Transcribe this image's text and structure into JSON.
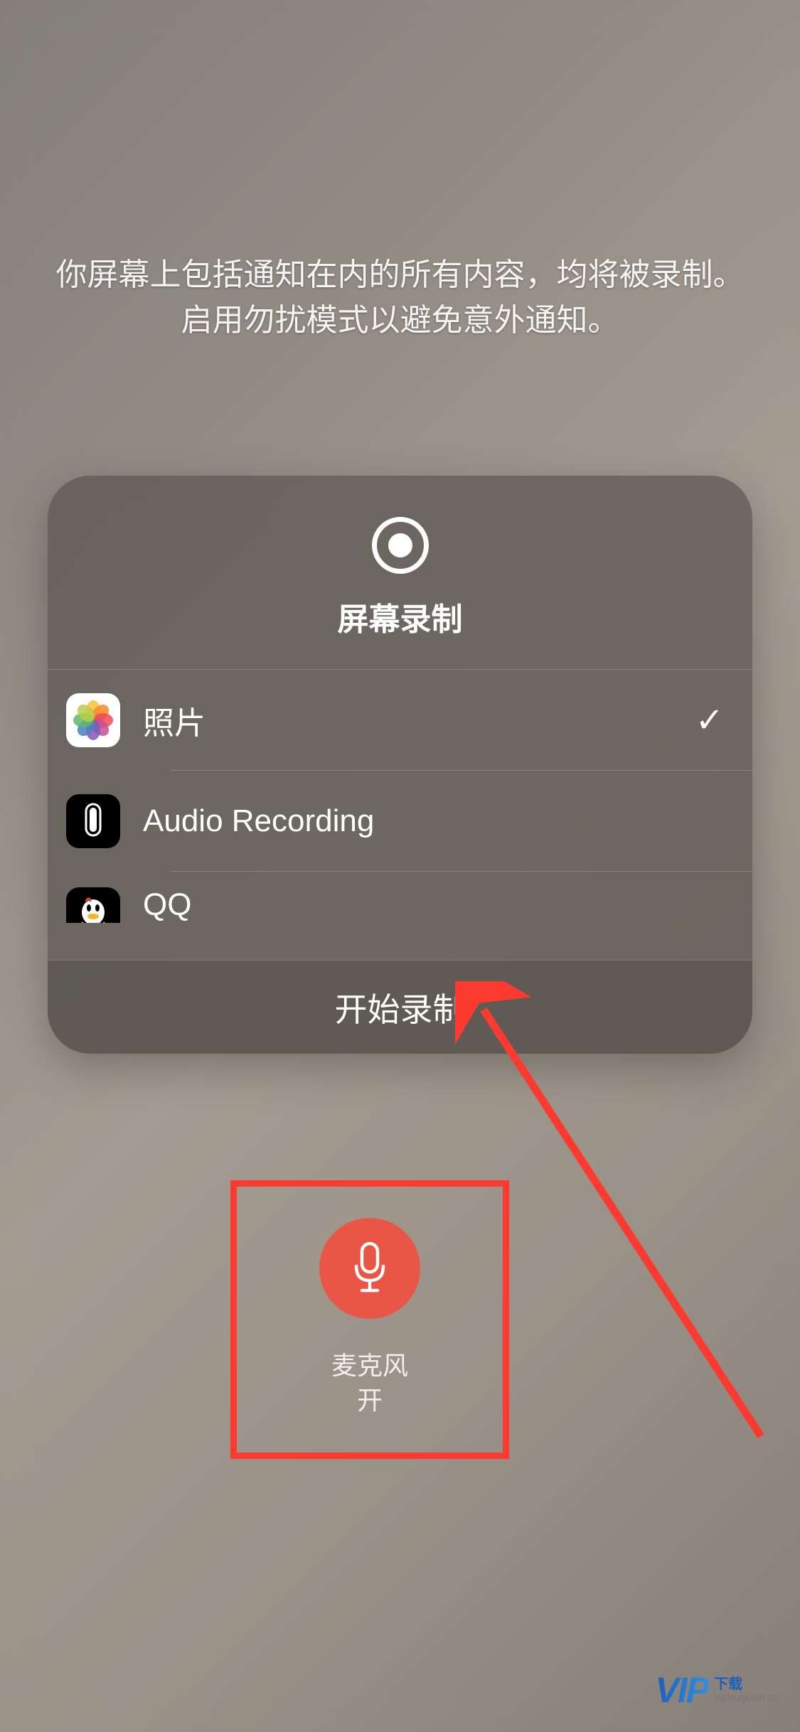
{
  "warning": "你屏幕上包括通知在内的所有内容，均将被录制。启用勿扰模式以避免意外通知。",
  "card": {
    "title": "屏幕录制",
    "options": [
      {
        "label": "照片",
        "selected": true,
        "icon": "photos"
      },
      {
        "label": "Audio Recording",
        "selected": false,
        "icon": "audio"
      },
      {
        "label": "QQ",
        "selected": false,
        "icon": "qq"
      }
    ],
    "start_button": "开始录制"
  },
  "mic": {
    "label_line1": "麦克风",
    "label_line2": "开"
  },
  "watermark": {
    "logo": "VIP",
    "cn": "下载",
    "url": "viphuiyuan.cc"
  },
  "annotation": {
    "arrow_color": "#fd3a2f",
    "box_color": "#fd3a2f"
  }
}
